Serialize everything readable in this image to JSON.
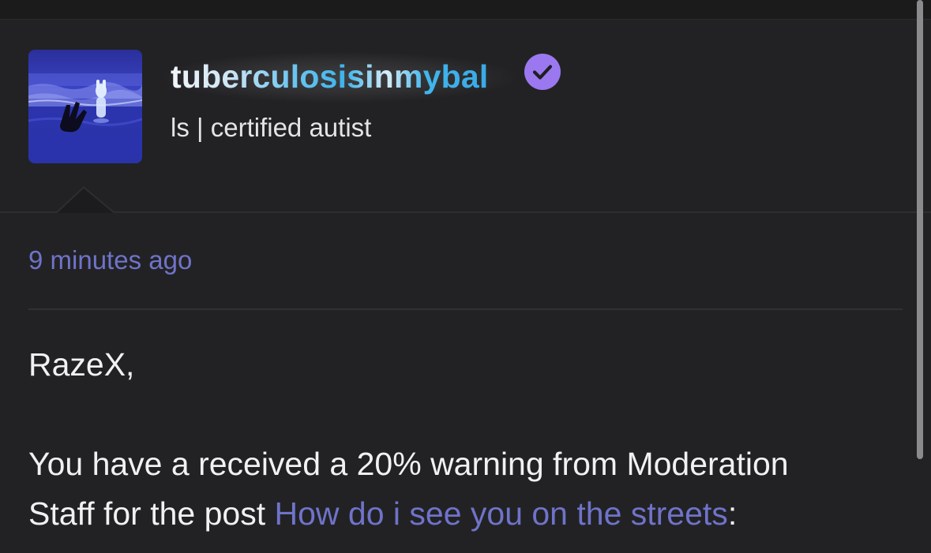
{
  "profile": {
    "username": "tuberculosisinmybal",
    "subtitle": "ls | certified autist",
    "verified": true,
    "colors": {
      "username_gradient_start": "#f2f6fb",
      "username_gradient_end": "#3aa9e6",
      "verified_badge": "#9b78f0"
    }
  },
  "message": {
    "timestamp": "9 minutes ago",
    "greeting": "RazeX,",
    "line1": "You have a received a 20% warning from Moderation",
    "line2_prefix": "Staff for the post ",
    "post_link": "How do i see you on the streets",
    "line2_suffix": ":"
  },
  "theme": {
    "background": "#222224",
    "link_color": "#6f73c9",
    "text_color": "#f1f1f3"
  },
  "icons": {
    "verified": "verified-check-icon",
    "avatar": "avatar-image"
  }
}
